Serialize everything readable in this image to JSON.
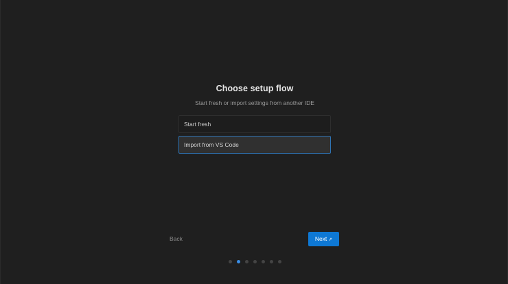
{
  "header": {
    "title": "Choose setup flow",
    "subtitle": "Start fresh or import settings from another IDE"
  },
  "options": [
    {
      "label": "Start fresh",
      "selected": false
    },
    {
      "label": "Import from VS Code",
      "selected": true
    }
  ],
  "footer": {
    "back_label": "Back",
    "next_label": "Next",
    "next_icon": "external-link-icon",
    "accent_color": "#0e78d4"
  },
  "progress": {
    "total_steps": 7,
    "current_step": 2
  }
}
